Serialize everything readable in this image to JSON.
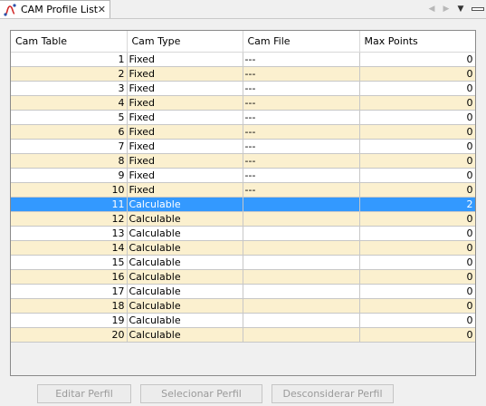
{
  "tab": {
    "title": "CAM Profile List",
    "close": "✕"
  },
  "table": {
    "headers": [
      "Cam Table",
      "Cam Type",
      "Cam File",
      "Max Points"
    ],
    "selected_row": 11,
    "rows": [
      {
        "table": "1",
        "type": "Fixed",
        "file": "---",
        "max_points": "0"
      },
      {
        "table": "2",
        "type": "Fixed",
        "file": "---",
        "max_points": "0"
      },
      {
        "table": "3",
        "type": "Fixed",
        "file": "---",
        "max_points": "0"
      },
      {
        "table": "4",
        "type": "Fixed",
        "file": "---",
        "max_points": "0"
      },
      {
        "table": "5",
        "type": "Fixed",
        "file": "---",
        "max_points": "0"
      },
      {
        "table": "6",
        "type": "Fixed",
        "file": "---",
        "max_points": "0"
      },
      {
        "table": "7",
        "type": "Fixed",
        "file": "---",
        "max_points": "0"
      },
      {
        "table": "8",
        "type": "Fixed",
        "file": "---",
        "max_points": "0"
      },
      {
        "table": "9",
        "type": "Fixed",
        "file": "---",
        "max_points": "0"
      },
      {
        "table": "10",
        "type": "Fixed",
        "file": "---",
        "max_points": "0"
      },
      {
        "table": "11",
        "type": "Calculable",
        "file": "",
        "max_points": "2"
      },
      {
        "table": "12",
        "type": "Calculable",
        "file": "",
        "max_points": "0"
      },
      {
        "table": "13",
        "type": "Calculable",
        "file": "",
        "max_points": "0"
      },
      {
        "table": "14",
        "type": "Calculable",
        "file": "",
        "max_points": "0"
      },
      {
        "table": "15",
        "type": "Calculable",
        "file": "",
        "max_points": "0"
      },
      {
        "table": "16",
        "type": "Calculable",
        "file": "",
        "max_points": "0"
      },
      {
        "table": "17",
        "type": "Calculable",
        "file": "",
        "max_points": "0"
      },
      {
        "table": "18",
        "type": "Calculable",
        "file": "",
        "max_points": "0"
      },
      {
        "table": "19",
        "type": "Calculable",
        "file": "",
        "max_points": "0"
      },
      {
        "table": "20",
        "type": "Calculable",
        "file": "",
        "max_points": "0"
      }
    ]
  },
  "buttons": {
    "edit": "Editar Perfil",
    "select": "Selecionar Perfil",
    "disregard": "Desconsiderar Perfil"
  },
  "colors": {
    "row_even": "#fbf0cf",
    "row_odd": "#ffffff",
    "selection": "#3399ff"
  },
  "icons": {
    "tab": "cam-profile-icon",
    "back": "nav-back-icon",
    "forward": "nav-forward-icon",
    "menu": "view-menu-icon",
    "minimize": "minimize-icon"
  }
}
